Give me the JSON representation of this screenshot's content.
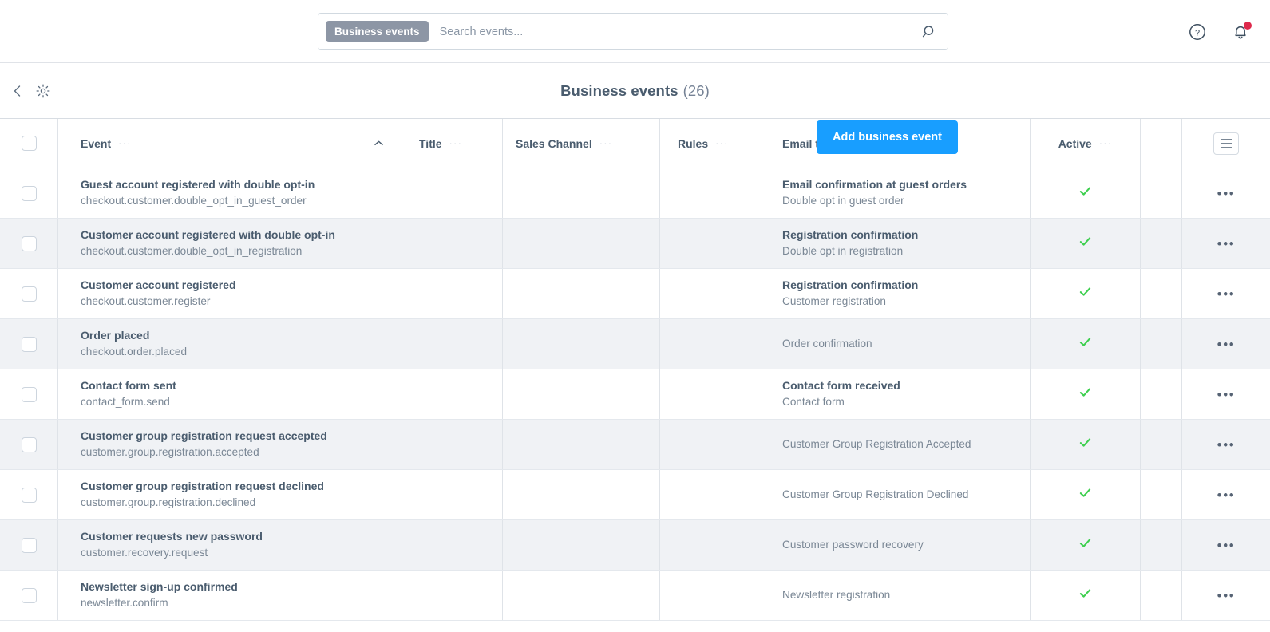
{
  "topbar": {
    "scope_pill": "Business events",
    "search_placeholder": "Search events...",
    "search_value": "",
    "search_icon": "search-icon",
    "help_icon": "help-circle-icon",
    "notifications_icon": "bell-icon",
    "has_notification": true
  },
  "header": {
    "back_icon": "chevron-left-icon",
    "settings_icon": "gear-icon",
    "title": "Business events",
    "count": "(26)",
    "add_button": "Add business event"
  },
  "table": {
    "columns": [
      {
        "label": "Event",
        "dots": "···",
        "sorted": "asc"
      },
      {
        "label": "Title",
        "dots": "···"
      },
      {
        "label": "Sales Channel",
        "dots": "···"
      },
      {
        "label": "Rules",
        "dots": "···"
      },
      {
        "label": "Email template",
        "dots": "···"
      },
      {
        "label": "Active",
        "dots": "···"
      }
    ],
    "settings_button_icon": "list-settings-icon",
    "row_action_dots": "•••",
    "active_icon": "check-icon",
    "active_color": "#3ecf4f",
    "rows": [
      {
        "event_name": "Guest account registered with double opt-in",
        "event_key": "checkout.customer.double_opt_in_guest_order",
        "title": "",
        "sales_channel": "",
        "rules": "",
        "template_name": "Email confirmation at guest orders",
        "template_sub": "Double opt in guest order",
        "active": true
      },
      {
        "event_name": "Customer account registered with double opt-in",
        "event_key": "checkout.customer.double_opt_in_registration",
        "title": "",
        "sales_channel": "",
        "rules": "",
        "template_name": "Registration confirmation",
        "template_sub": "Double opt in registration",
        "active": true
      },
      {
        "event_name": "Customer account registered",
        "event_key": "checkout.customer.register",
        "title": "",
        "sales_channel": "",
        "rules": "",
        "template_name": "Registration confirmation",
        "template_sub": "Customer registration",
        "active": true
      },
      {
        "event_name": "Order placed",
        "event_key": "checkout.order.placed",
        "title": "",
        "sales_channel": "",
        "rules": "",
        "template_name": "",
        "template_sub": "Order confirmation",
        "active": true
      },
      {
        "event_name": "Contact form sent",
        "event_key": "contact_form.send",
        "title": "",
        "sales_channel": "",
        "rules": "",
        "template_name": "Contact form received",
        "template_sub": "Contact form",
        "active": true
      },
      {
        "event_name": "Customer group registration request accepted",
        "event_key": "customer.group.registration.accepted",
        "title": "",
        "sales_channel": "",
        "rules": "",
        "template_name": "",
        "template_sub": "Customer Group Registration Accepted",
        "active": true
      },
      {
        "event_name": "Customer group registration request declined",
        "event_key": "customer.group.registration.declined",
        "title": "",
        "sales_channel": "",
        "rules": "",
        "template_name": "",
        "template_sub": "Customer Group Registration Declined",
        "active": true
      },
      {
        "event_name": "Customer requests new password",
        "event_key": "customer.recovery.request",
        "title": "",
        "sales_channel": "",
        "rules": "",
        "template_name": "",
        "template_sub": "Customer password recovery",
        "active": true
      },
      {
        "event_name": "Newsletter sign-up confirmed",
        "event_key": "newsletter.confirm",
        "title": "",
        "sales_channel": "",
        "rules": "",
        "template_name": "",
        "template_sub": "Newsletter registration",
        "active": true
      }
    ]
  },
  "colors": {
    "accent": "#189eff",
    "pill": "#8d96a5",
    "check": "#3ecf4f",
    "notification": "#de294c"
  }
}
